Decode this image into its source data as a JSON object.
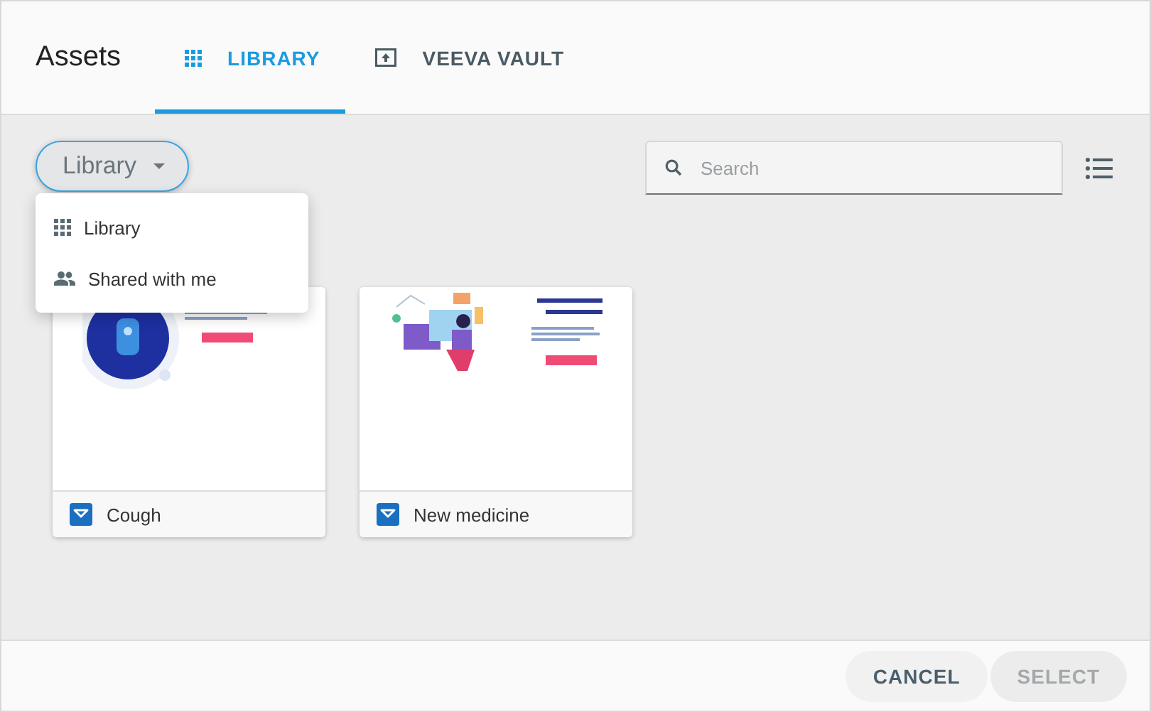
{
  "header": {
    "title": "Assets",
    "tabs": [
      {
        "label": "LIBRARY",
        "kind": "grid",
        "selected": true
      },
      {
        "label": "VEEVA VAULT",
        "kind": "upload",
        "selected": false
      }
    ]
  },
  "toolbar": {
    "source_dropdown": {
      "value": "Library",
      "expanded": true,
      "options": [
        {
          "label": "Library",
          "kind": "grid"
        },
        {
          "label": "Shared with me",
          "kind": "people"
        }
      ]
    },
    "search": {
      "placeholder": "Search"
    }
  },
  "assets": [
    {
      "name": "Cough",
      "kind": "circle-figure"
    },
    {
      "name": "New medicine",
      "kind": "person-laptop"
    }
  ],
  "footer": {
    "buttons": [
      {
        "label": "CANCEL",
        "disabled": false
      },
      {
        "label": "SELECT",
        "disabled": true
      }
    ]
  }
}
